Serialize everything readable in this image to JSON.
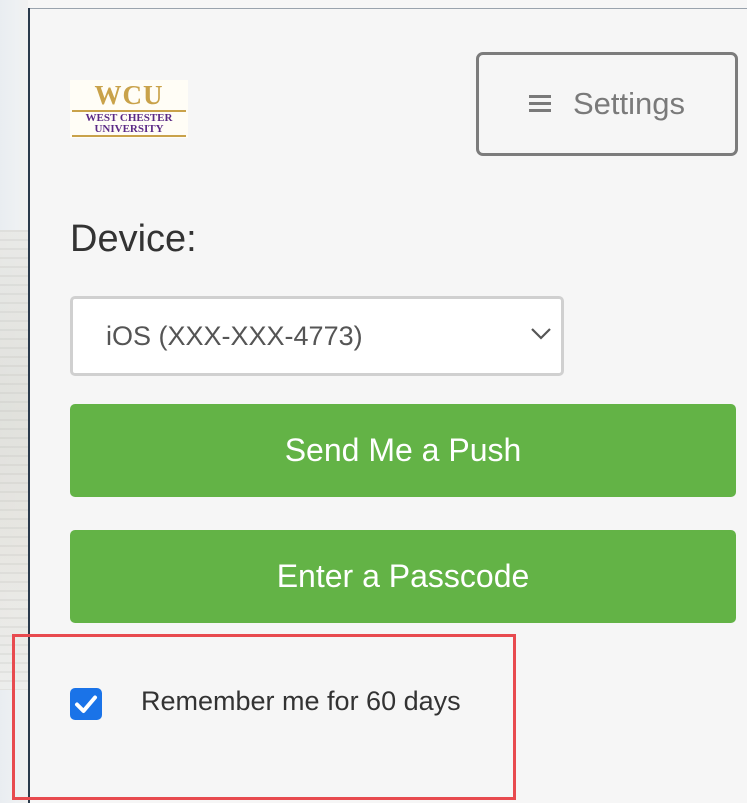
{
  "logo": {
    "initials": "WCU",
    "line1": "WEST CHESTER",
    "line2": "UNIVERSITY"
  },
  "settings": {
    "label": "Settings",
    "icon": "hamburger-menu-icon"
  },
  "device": {
    "label": "Device:",
    "selected": "iOS (XXX-XXX-4773)"
  },
  "actions": {
    "push_label": "Send Me a Push",
    "passcode_label": "Enter a Passcode"
  },
  "remember": {
    "label": "Remember me for 60 days",
    "checked": true
  },
  "colors": {
    "primary_green": "#63b346",
    "checkbox_blue": "#1a73e8",
    "highlight_red": "#e84a4f",
    "logo_gold": "#c9a24a",
    "logo_purple": "#5b2a86"
  }
}
